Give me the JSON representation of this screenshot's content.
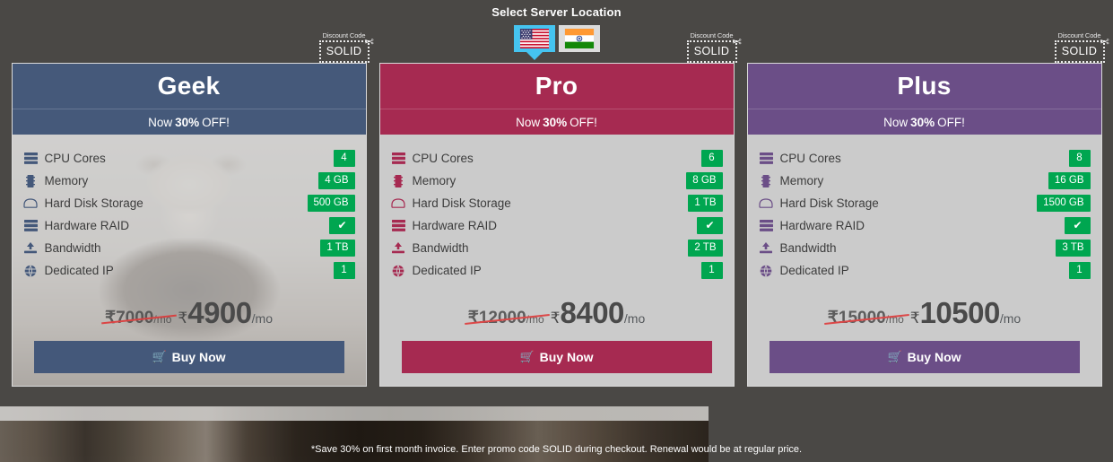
{
  "header": {
    "title": "Select Server Location",
    "locations": [
      {
        "name": "united-states",
        "label": "United States",
        "selected": true
      },
      {
        "name": "india",
        "label": "India",
        "selected": false
      }
    ]
  },
  "coupon": {
    "label": "Discount Code",
    "code": "SOLID",
    "icon": "scissors-icon"
  },
  "feature_labels": [
    "CPU Cores",
    "Memory",
    "Hard Disk Storage",
    "Hardware RAID",
    "Bandwidth",
    "Dedicated IP"
  ],
  "feature_icons": [
    "server-icon",
    "memory-chip-icon",
    "hard-drive-icon",
    "server-icon",
    "upload-icon",
    "globe-icon"
  ],
  "ribbon": {
    "prefix": "Now",
    "percent": "30%",
    "suffix": "OFF!"
  },
  "buy_label": "Buy Now",
  "cart_icon": "shopping-cart-icon",
  "currency": "₹",
  "per_month": "/mo",
  "colors": {
    "geek": "#44587a",
    "pro": "#a62a51",
    "plus": "#6b4e87",
    "badge_green": "#00a650",
    "strike_red": "#e03131",
    "page_bg": "#4a4845",
    "card_bg": "#cbcbcb",
    "flag_active": "#45c4f0"
  },
  "plans": [
    {
      "name": "Geek",
      "theme": "geek",
      "values": [
        "4",
        "4 GB",
        "500 GB",
        "✔",
        "1 TB",
        "1"
      ],
      "old_price": "7000",
      "new_price": "4900"
    },
    {
      "name": "Pro",
      "theme": "pro",
      "values": [
        "6",
        "8 GB",
        "1 TB",
        "✔",
        "2 TB",
        "1"
      ],
      "old_price": "12000",
      "new_price": "8400"
    },
    {
      "name": "Plus",
      "theme": "plus",
      "values": [
        "8",
        "16 GB",
        "1500 GB",
        "✔",
        "3 TB",
        "1"
      ],
      "old_price": "15000",
      "new_price": "10500"
    }
  ],
  "footnote": "*Save 30% on first month invoice. Enter promo code SOLID during checkout. Renewal would be at regular price."
}
